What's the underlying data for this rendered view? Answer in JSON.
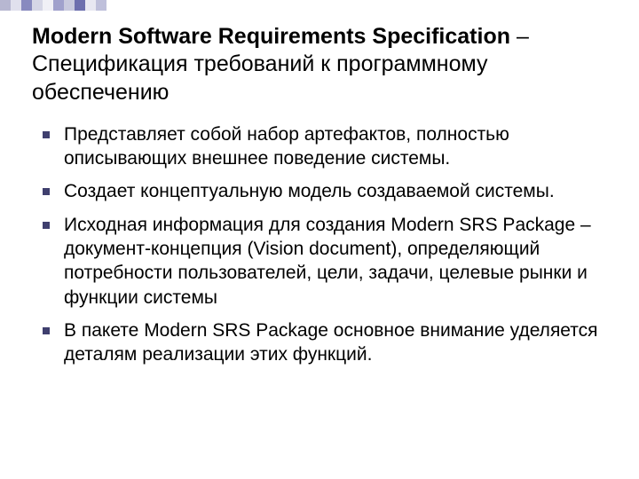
{
  "deco": {
    "colors": [
      "#b7b7d1",
      "#e0e0ed",
      "#888abf",
      "#d5d6e6",
      "#f0f0f6",
      "#a0a1cc",
      "#c8c9de",
      "#6d6fae",
      "#e8e8f2",
      "#bfc0db"
    ]
  },
  "title": {
    "bold": "Modern Software Requirements Specification",
    "rest": " – Спецификация требований к программному обеспечению"
  },
  "bullets": [
    "Представляет собой набор артефактов, полностью описывающих внешнее поведение системы.",
    "Создает концептуальную модель создаваемой системы.",
    "Исходная информация для создания Modern SRS Package – документ-концепция (Vision document), определяющий потребности пользователей, цели, задачи, целевые рынки и функции системы",
    "В пакете Modern SRS Package основное внимание уделяется деталям реализации этих функций."
  ]
}
